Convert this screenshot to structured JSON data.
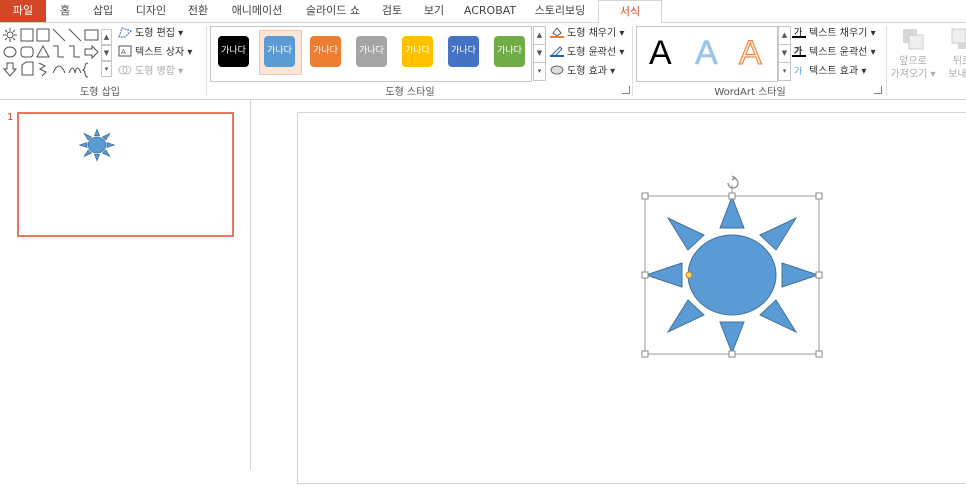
{
  "tabs": [
    {
      "label": "파일",
      "active": false,
      "file": true
    },
    {
      "label": "홈"
    },
    {
      "label": "삽입"
    },
    {
      "label": "디자인"
    },
    {
      "label": "전환"
    },
    {
      "label": "애니메이션"
    },
    {
      "label": "슬라이드 쇼"
    },
    {
      "label": "검토"
    },
    {
      "label": "보기"
    },
    {
      "label": "ACROBAT"
    },
    {
      "label": "스토리보딩"
    },
    {
      "label": "서식",
      "active": true
    }
  ],
  "ribbon": {
    "insert_shapes": {
      "label": "도형 삽입",
      "edit_shape": "도형 편집",
      "text_box": "텍스트 상자",
      "merge_shapes": "도형 병합"
    },
    "shape_styles": {
      "label": "도형 스타일",
      "sample_text": "가나다",
      "swatches": [
        "#000000",
        "#5b9bd5",
        "#ed7d31",
        "#a5a5a5",
        "#ffc000",
        "#4472c4",
        "#70ad47"
      ],
      "selected_index": 1,
      "fill": "도형 채우기",
      "outline": "도형 윤곽선",
      "effects": "도형 효과"
    },
    "wordart": {
      "label": "WordArt 스타일",
      "letter": "A",
      "text_fill": "텍스트 채우기",
      "text_outline": "텍스트 윤곽선",
      "text_effects": "텍스트 효과"
    },
    "arrange": {
      "bring_forward_1": "앞으로",
      "bring_forward_2": "가져오기",
      "send_backward_1": "뒤로",
      "send_backward_2": "보내기"
    }
  },
  "slides": [
    {
      "number": "1"
    }
  ],
  "colors": {
    "accent": "#d24726",
    "sun_fill": "#5b9bd5",
    "sun_stroke": "#41719c",
    "thumb_border": "#e8765a"
  }
}
